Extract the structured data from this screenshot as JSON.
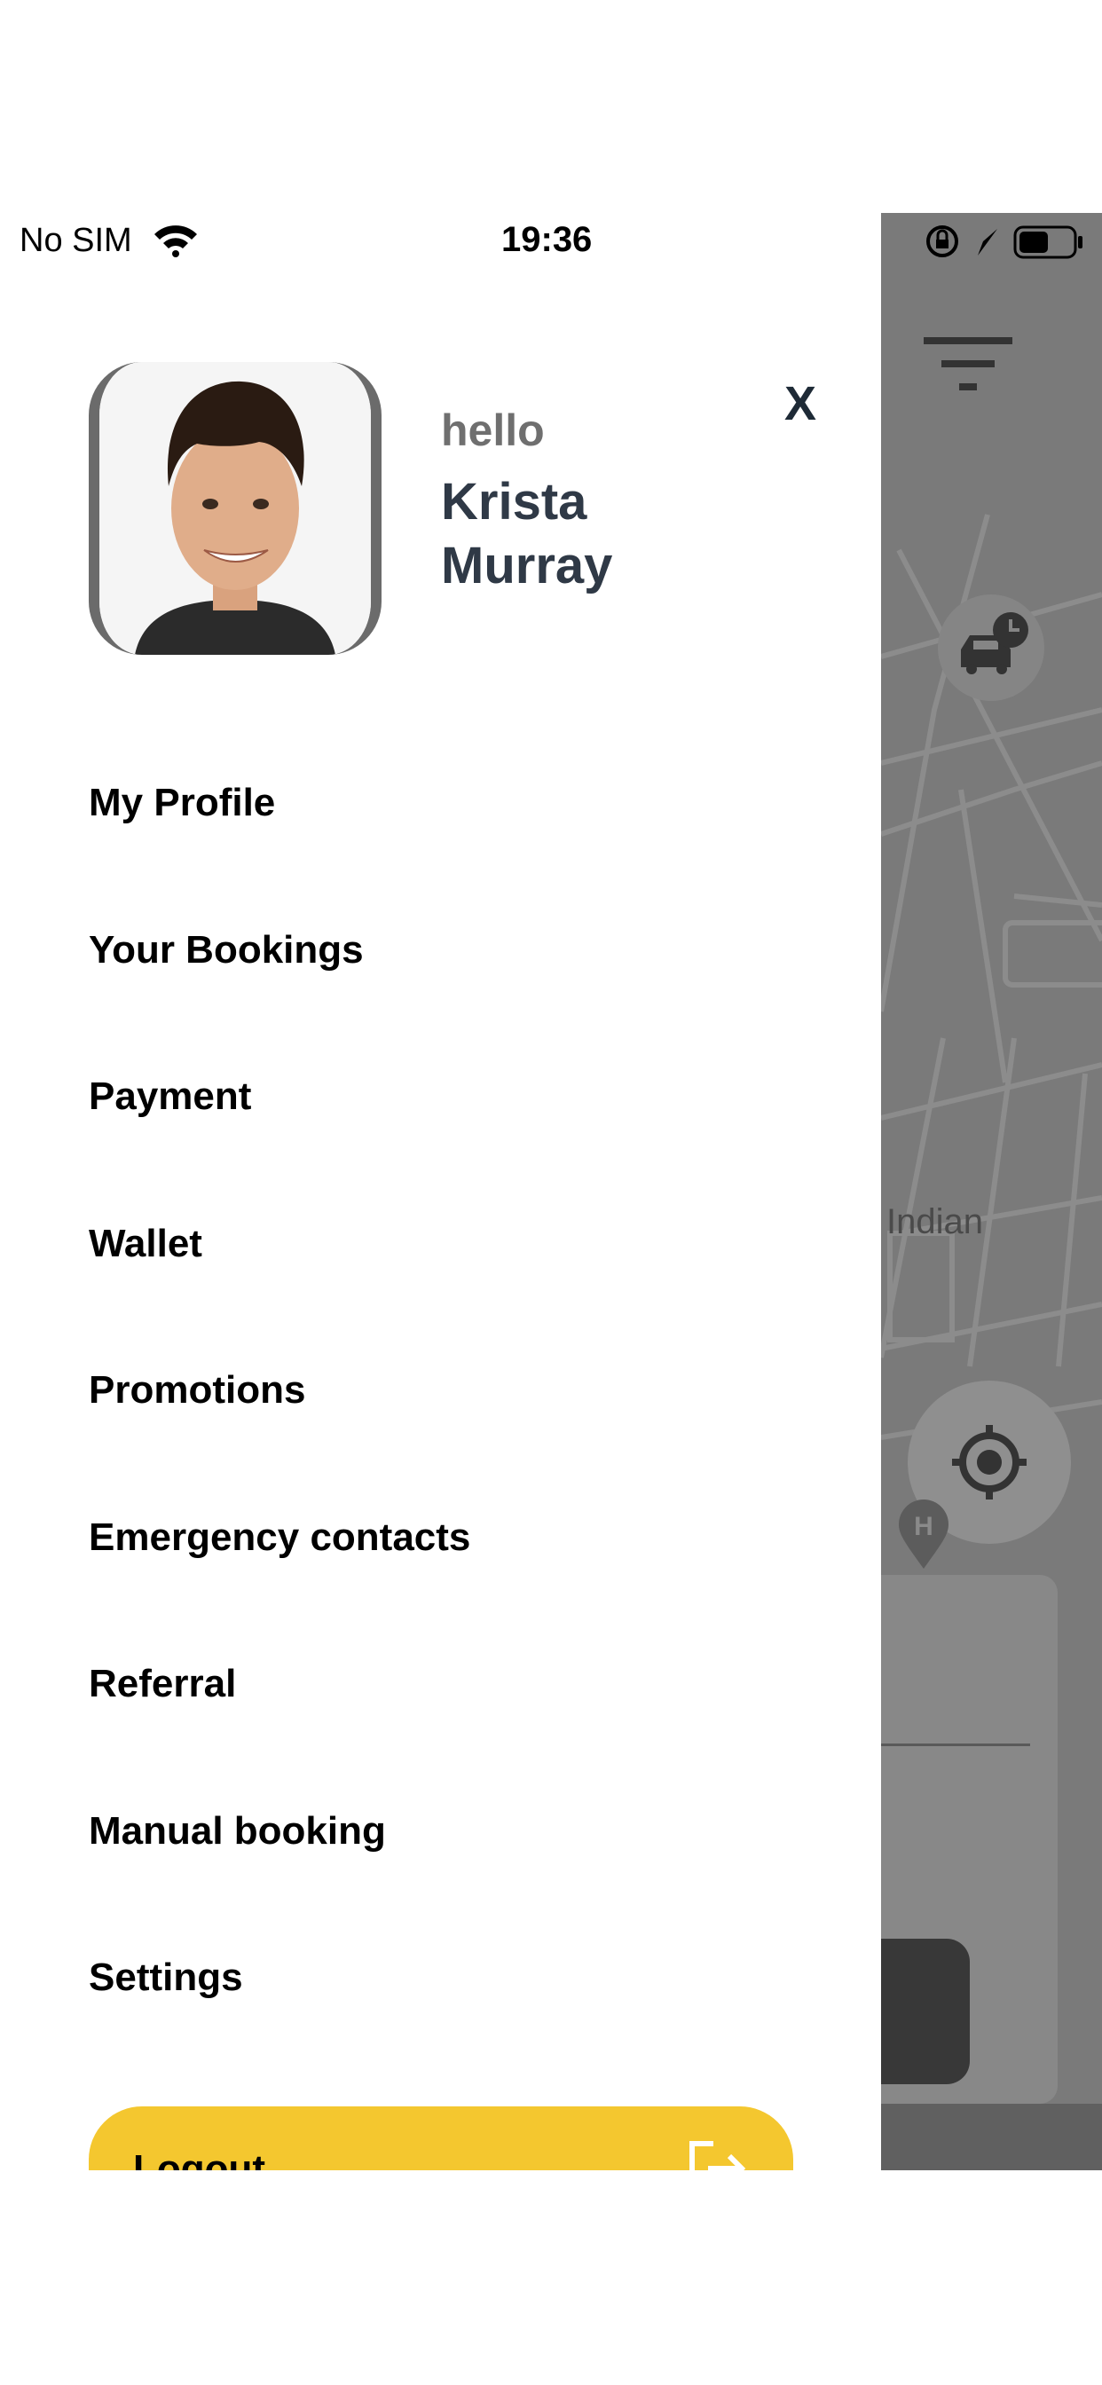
{
  "status_bar": {
    "carrier": "No SIM",
    "time": "19:36"
  },
  "drawer": {
    "greeting": "hello",
    "user_first_name": "Krista",
    "user_last_name": "Murray",
    "close_label": "X",
    "menu_items": [
      {
        "label": "My Profile"
      },
      {
        "label": "Your Bookings"
      },
      {
        "label": "Payment"
      },
      {
        "label": "Wallet"
      },
      {
        "label": "Promotions"
      },
      {
        "label": "Emergency contacts"
      },
      {
        "label": "Referral"
      },
      {
        "label": "Manual booking"
      },
      {
        "label": "Settings"
      }
    ],
    "logout_label": "Logout"
  },
  "map": {
    "labels": [
      "Indian",
      "H"
    ]
  },
  "colors": {
    "accent": "#f4c72f",
    "name_text": "#2f3946",
    "overlay": "#7a7a7a"
  },
  "icons": [
    "wifi-icon",
    "lock-rotation-icon",
    "location-arrow-icon",
    "battery-icon",
    "filter-icon",
    "scheduled-car-icon",
    "my-location-icon",
    "hospital-marker-icon",
    "logout-icon"
  ]
}
